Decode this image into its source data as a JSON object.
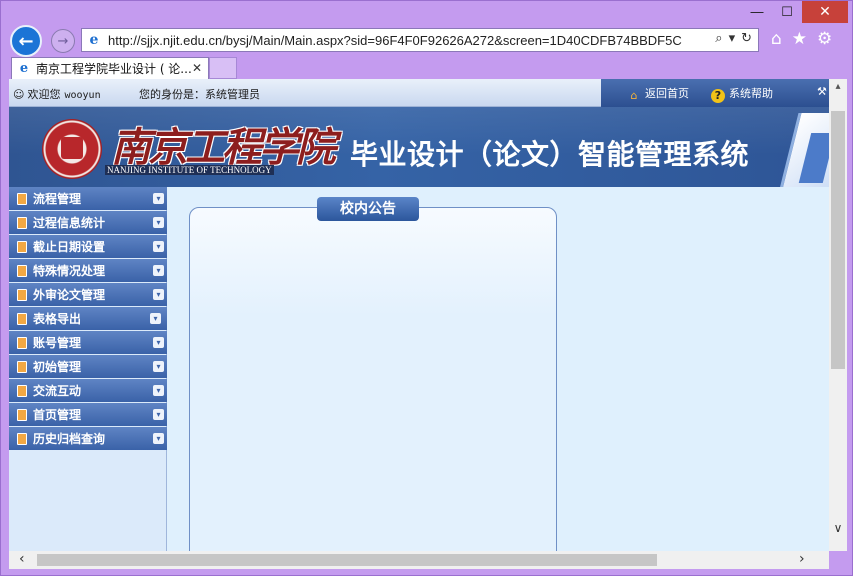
{
  "browser": {
    "url": "http://sjjx.njit.edu.cn/bysj/Main/Main.aspx?sid=96F4F0F92626A272&screen=1D40CDFB74BBDF5C",
    "tab_title": "南京工程学院毕业设计 ( 论...",
    "icons": {
      "back": "back-arrow-icon",
      "forward": "forward-arrow-icon",
      "search": "search-icon",
      "refresh": "refresh-icon",
      "home": "home-icon",
      "favorites": "star-icon",
      "settings": "gear-icon"
    }
  },
  "topbar": {
    "welcome_label": "欢迎您",
    "username": "wooyun",
    "role_text": "您的身份是：系统管理员",
    "home_link": "返回首页",
    "help_link": "系统帮助"
  },
  "banner": {
    "school_name": "南京工程学院",
    "school_name_en": "NANJING INSTITUTE OF TECHNOLOGY",
    "system_title": "毕业设计（论文）智能管理系统"
  },
  "sidebar": {
    "items": [
      {
        "label": "流程管理"
      },
      {
        "label": "过程信息统计"
      },
      {
        "label": "截止日期设置"
      },
      {
        "label": "特殊情况处理"
      },
      {
        "label": "外审论文管理"
      },
      {
        "label": "表格导出"
      },
      {
        "label": "账号管理"
      },
      {
        "label": "初始管理"
      },
      {
        "label": "交流互动"
      },
      {
        "label": "首页管理"
      },
      {
        "label": "历史归档查询"
      }
    ]
  },
  "main": {
    "notice_title": "校内公告"
  },
  "colors": {
    "window_frame": "#c49bef",
    "banner": "#3563a6",
    "menu_item": "#3a62a8",
    "content_bg": "#dff0fd"
  }
}
